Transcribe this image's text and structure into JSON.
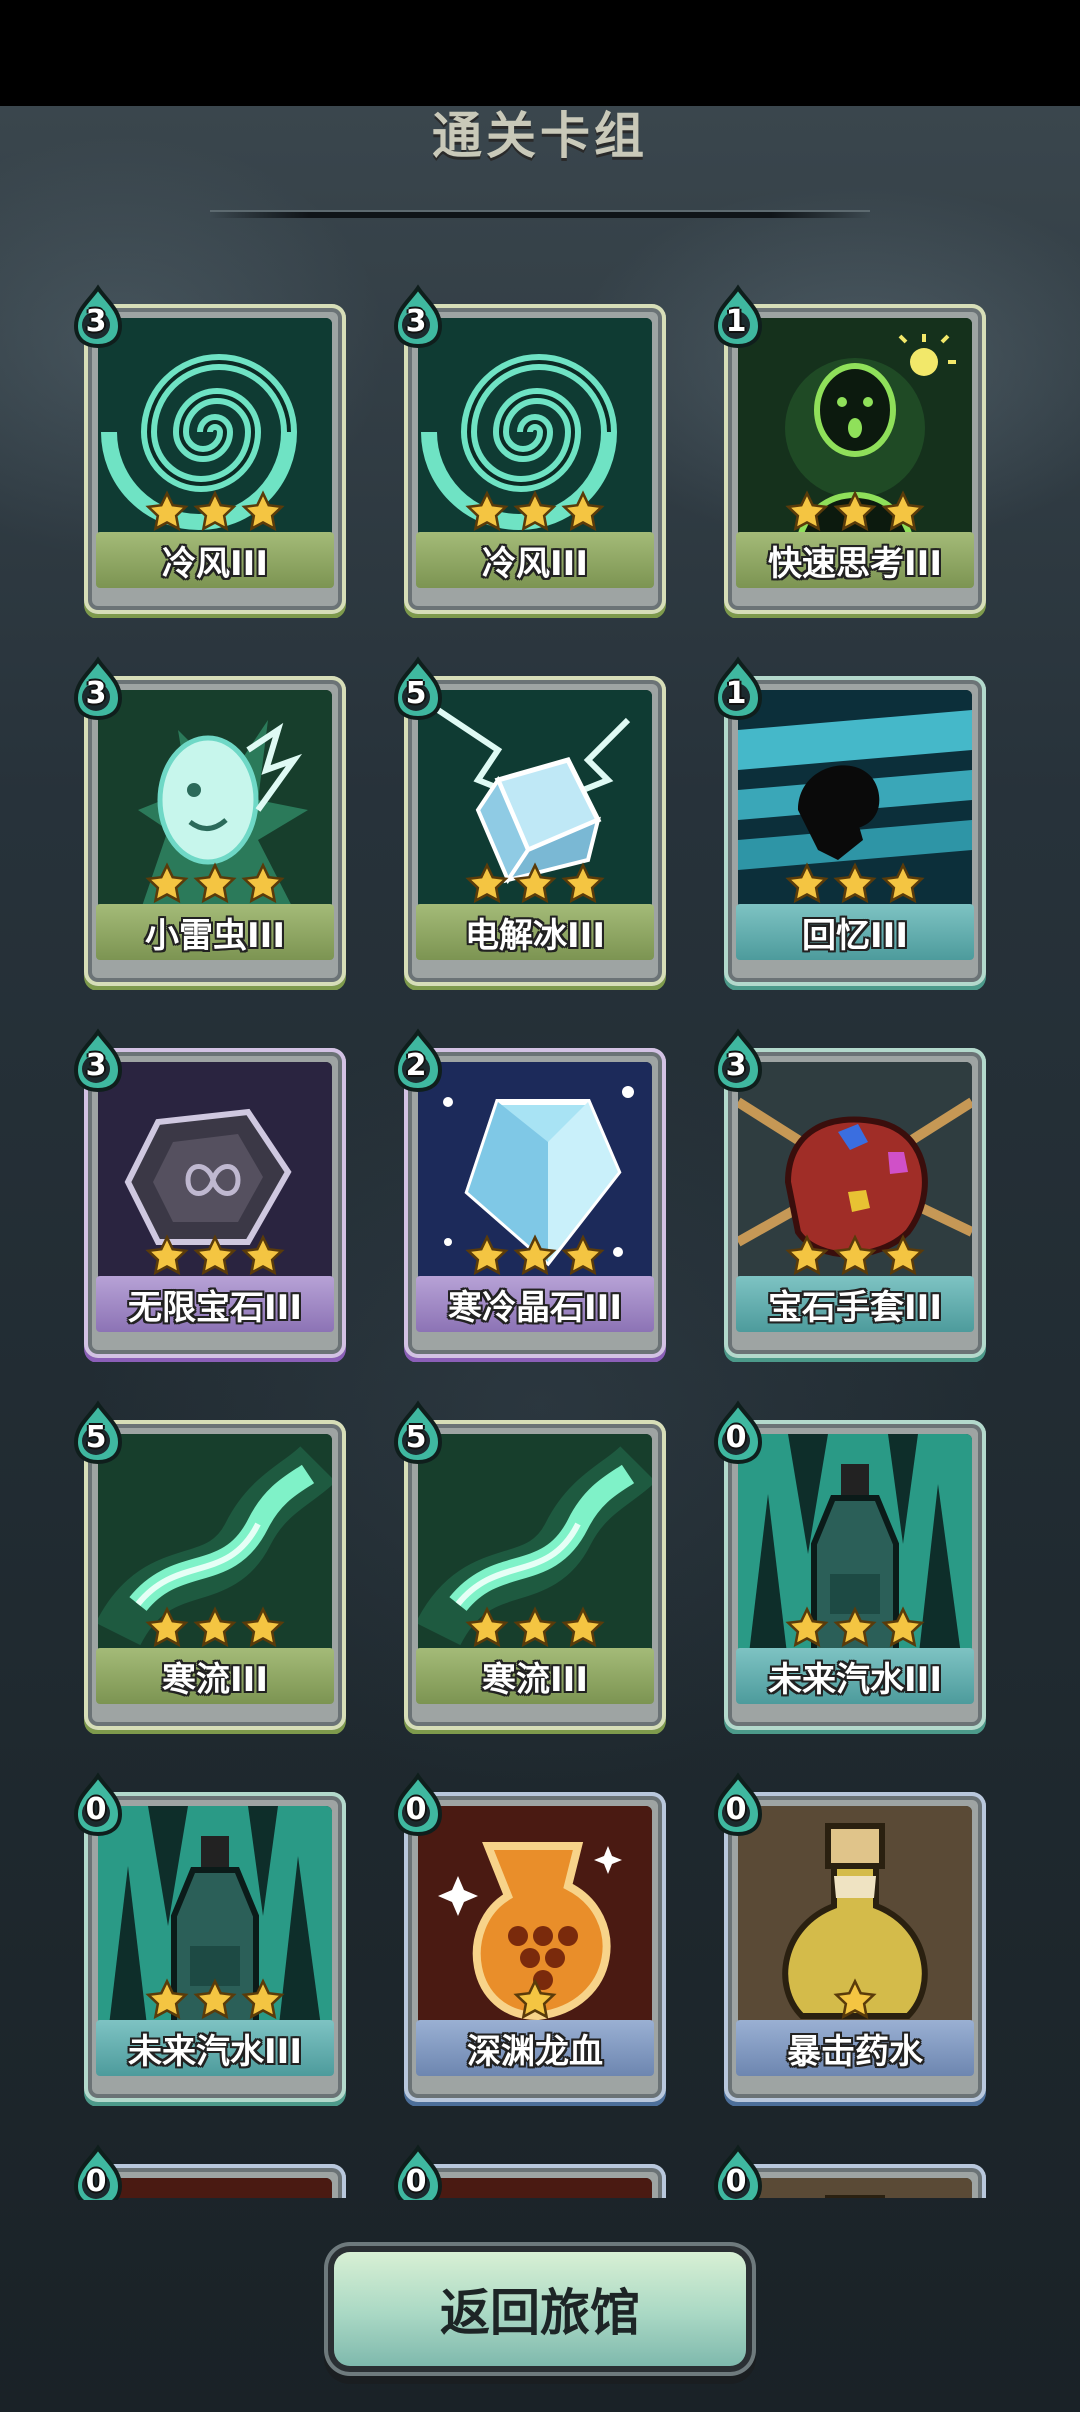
{
  "header": {
    "title": "通关卡组"
  },
  "cards": [
    {
      "name": "冷风III",
      "cost": "3",
      "stars": 3,
      "art": "vortex",
      "label_color": "green",
      "frame": "green"
    },
    {
      "name": "冷风III",
      "cost": "3",
      "stars": 3,
      "art": "vortex",
      "label_color": "green",
      "frame": "green"
    },
    {
      "name": "快速思考III",
      "cost": "1",
      "stars": 3,
      "art": "idea",
      "label_color": "green",
      "frame": "green"
    },
    {
      "name": "小雷虫III",
      "cost": "3",
      "stars": 3,
      "art": "thunder-bug",
      "label_color": "green",
      "frame": "green"
    },
    {
      "name": "电解冰III",
      "cost": "5",
      "stars": 3,
      "art": "ice-cube",
      "label_color": "green",
      "frame": "green"
    },
    {
      "name": "回忆III",
      "cost": "1",
      "stars": 3,
      "art": "memory",
      "label_color": "teal",
      "frame": "teal"
    },
    {
      "name": "无限宝石III",
      "cost": "3",
      "stars": 3,
      "art": "infinity-gem",
      "label_color": "purple",
      "frame": "purple"
    },
    {
      "name": "寒冷晶石III",
      "cost": "2",
      "stars": 3,
      "art": "ice-crystal",
      "label_color": "purple",
      "frame": "purple"
    },
    {
      "name": "宝石手套III",
      "cost": "3",
      "stars": 3,
      "art": "gem-gauntlet",
      "label_color": "teal",
      "frame": "teal"
    },
    {
      "name": "寒流III",
      "cost": "5",
      "stars": 3,
      "art": "cold-stream",
      "label_color": "green",
      "frame": "green"
    },
    {
      "name": "寒流III",
      "cost": "5",
      "stars": 3,
      "art": "cold-stream",
      "label_color": "green",
      "frame": "green"
    },
    {
      "name": "未来汽水III",
      "cost": "0",
      "stars": 3,
      "art": "soda",
      "label_color": "teal",
      "frame": "teal"
    },
    {
      "name": "未来汽水III",
      "cost": "0",
      "stars": 3,
      "art": "soda",
      "label_color": "teal",
      "frame": "teal"
    },
    {
      "name": "深渊龙血",
      "cost": "0",
      "stars": 1,
      "art": "dragon-blood",
      "label_color": "blue",
      "frame": "blue"
    },
    {
      "name": "暴击药水",
      "cost": "0",
      "stars": 1,
      "art": "crit-potion",
      "label_color": "blue",
      "frame": "blue"
    },
    {
      "name": "",
      "cost": "0",
      "stars": 0,
      "art": "dragon-blood",
      "label_color": "blue",
      "frame": "blue"
    },
    {
      "name": "",
      "cost": "0",
      "stars": 0,
      "art": "dragon-blood",
      "label_color": "blue",
      "frame": "blue"
    },
    {
      "name": "",
      "cost": "0",
      "stars": 0,
      "art": "crit-potion",
      "label_color": "blue",
      "frame": "blue"
    }
  ],
  "footer": {
    "return_label": "返回旅馆"
  },
  "colors": {
    "star": "#f4c542",
    "cost_drop": "#3fb8a0"
  }
}
